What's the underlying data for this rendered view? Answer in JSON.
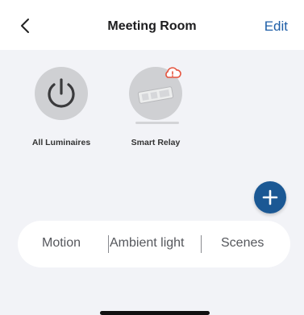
{
  "header": {
    "title": "Meeting Room",
    "edit_label": "Edit",
    "back_icon": "chevron-left-icon"
  },
  "devices": [
    {
      "label": "All Luminaires",
      "icon": "power-icon"
    },
    {
      "label": "Smart Relay",
      "icon": "relay-device-icon",
      "badge_icon": "cloud-warning-icon"
    }
  ],
  "fab": {
    "icon": "plus-icon"
  },
  "tabs": [
    {
      "label": "Motion"
    },
    {
      "label": "Ambient light"
    },
    {
      "label": "Scenes"
    }
  ],
  "colors": {
    "accent": "#1f5fa8",
    "fab": "#1b5894",
    "warning": "#e5533d",
    "background": "#f2f3f7"
  }
}
